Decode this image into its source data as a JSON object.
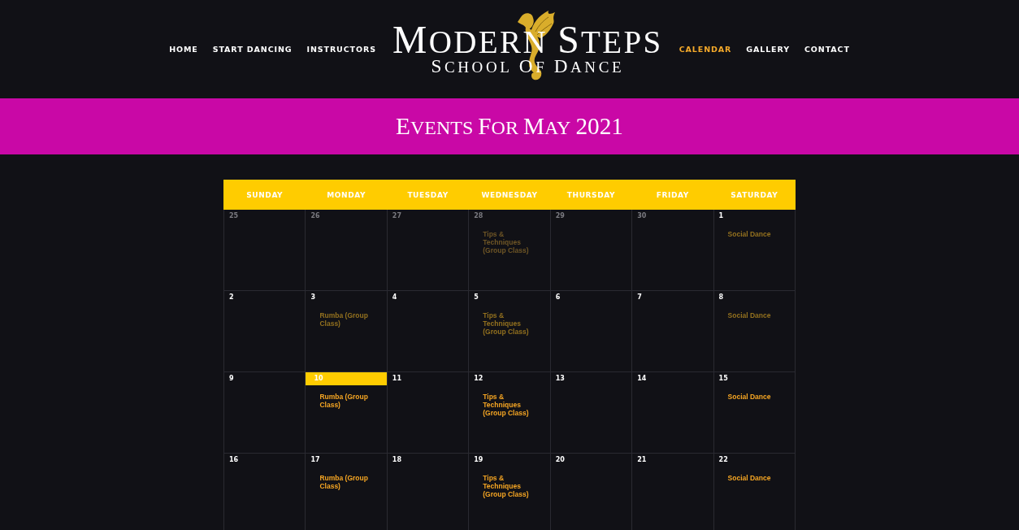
{
  "nav_left": [
    {
      "label": "HOME",
      "selected": false
    },
    {
      "label": "START DANCING",
      "selected": false
    },
    {
      "label": "INSTRUCTORS",
      "selected": false
    }
  ],
  "logo": {
    "title": "MODERN STEPS",
    "subtitle": "SCHOOL OF DANCE"
  },
  "nav_right": [
    {
      "label": "CALENDAR",
      "selected": true
    },
    {
      "label": "GALLERY",
      "selected": false
    },
    {
      "label": "CONTACT",
      "selected": false
    }
  ],
  "banner": {
    "title": "EVENTS FOR MAY 2021"
  },
  "calendar": {
    "weekdays": [
      "SUNDAY",
      "MONDAY",
      "TUESDAY",
      "WEDNESDAY",
      "THURSDAY",
      "FRIDAY",
      "SATURDAY"
    ],
    "weeks": [
      {
        "days": [
          {
            "date": "25",
            "other_month": true,
            "today": false
          },
          {
            "date": "26",
            "other_month": true,
            "today": false
          },
          {
            "date": "27",
            "other_month": true,
            "today": false
          },
          {
            "date": "28",
            "other_month": true,
            "today": false,
            "events": [
              {
                "title": "Tips & Techniques (Group Class)",
                "past": true
              }
            ]
          },
          {
            "date": "29",
            "other_month": true,
            "today": false
          },
          {
            "date": "30",
            "other_month": true,
            "today": false
          },
          {
            "date": "1",
            "other_month": false,
            "today": false,
            "events": [
              {
                "title": "Social Dance",
                "past": true
              }
            ]
          }
        ]
      },
      {
        "days": [
          {
            "date": "2",
            "other_month": false,
            "today": false
          },
          {
            "date": "3",
            "other_month": false,
            "today": false,
            "events": [
              {
                "title": "Rumba (Group Class)",
                "past": true
              }
            ]
          },
          {
            "date": "4",
            "other_month": false,
            "today": false
          },
          {
            "date": "5",
            "other_month": false,
            "today": false,
            "events": [
              {
                "title": "Tips & Techniques (Group Class)",
                "past": true
              }
            ]
          },
          {
            "date": "6",
            "other_month": false,
            "today": false
          },
          {
            "date": "7",
            "other_month": false,
            "today": false
          },
          {
            "date": "8",
            "other_month": false,
            "today": false,
            "events": [
              {
                "title": "Social Dance",
                "past": true
              }
            ]
          }
        ]
      },
      {
        "days": [
          {
            "date": "9",
            "other_month": false,
            "today": false
          },
          {
            "date": "10",
            "other_month": false,
            "today": true,
            "events": [
              {
                "title": "Rumba (Group Class)",
                "past": false
              }
            ]
          },
          {
            "date": "11",
            "other_month": false,
            "today": false
          },
          {
            "date": "12",
            "other_month": false,
            "today": false,
            "events": [
              {
                "title": "Tips & Techniques (Group Class)",
                "past": false
              }
            ]
          },
          {
            "date": "13",
            "other_month": false,
            "today": false
          },
          {
            "date": "14",
            "other_month": false,
            "today": false
          },
          {
            "date": "15",
            "other_month": false,
            "today": false,
            "events": [
              {
                "title": "Social Dance",
                "past": false
              }
            ]
          }
        ]
      },
      {
        "days": [
          {
            "date": "16",
            "other_month": false,
            "today": false
          },
          {
            "date": "17",
            "other_month": false,
            "today": false,
            "events": [
              {
                "title": "Rumba (Group Class)",
                "past": false
              }
            ]
          },
          {
            "date": "18",
            "other_month": false,
            "today": false
          },
          {
            "date": "19",
            "other_month": false,
            "today": false,
            "events": [
              {
                "title": "Tips & Techniques (Group Class)",
                "past": false
              }
            ]
          },
          {
            "date": "20",
            "other_month": false,
            "today": false
          },
          {
            "date": "21",
            "other_month": false,
            "today": false
          },
          {
            "date": "22",
            "other_month": false,
            "today": false,
            "events": [
              {
                "title": "Social Dance",
                "past": false
              }
            ]
          }
        ]
      }
    ]
  }
}
